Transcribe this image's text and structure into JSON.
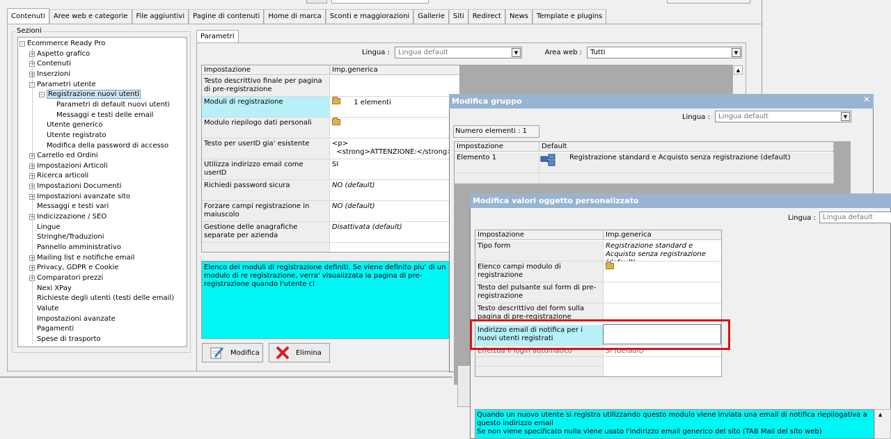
{
  "main_tabs": [
    "Contenuti",
    "Aree web e categorie",
    "File aggiuntivi",
    "Pagine di contenuti",
    "Home di marca",
    "Sconti e maggiorazioni",
    "Gallerie",
    "Siti",
    "Redirect",
    "News",
    "Template e plugins"
  ],
  "sections": {
    "legend": "Sezioni",
    "tree": [
      {
        "label": "Ecommerce Ready Pro",
        "level": 0,
        "exp": "-"
      },
      {
        "label": "Aspetto grafico",
        "level": 1,
        "exp": "+"
      },
      {
        "label": "Contenuti",
        "level": 1,
        "exp": "+"
      },
      {
        "label": "Inserzioni",
        "level": 1,
        "exp": "+"
      },
      {
        "label": "Parametri utente",
        "level": 1,
        "exp": "-"
      },
      {
        "label": "Registrazione nuovi utenti",
        "level": 2,
        "exp": "-",
        "selected": true
      },
      {
        "label": "Parametri di default nuovi utenti",
        "level": 3,
        "exp": ""
      },
      {
        "label": "Messaggi e testi delle email",
        "level": 3,
        "exp": ""
      },
      {
        "label": "Utente generico",
        "level": 2,
        "exp": ""
      },
      {
        "label": "Utente registrato",
        "level": 2,
        "exp": ""
      },
      {
        "label": "Modifica della password di accesso",
        "level": 2,
        "exp": ""
      },
      {
        "label": "Carrello ed Ordini",
        "level": 1,
        "exp": "+"
      },
      {
        "label": "Impostazioni Articoli",
        "level": 1,
        "exp": "+"
      },
      {
        "label": "Ricerca articoli",
        "level": 1,
        "exp": "+"
      },
      {
        "label": "Impostazioni Documenti",
        "level": 1,
        "exp": "+"
      },
      {
        "label": "Impostazioni avanzate sito",
        "level": 1,
        "exp": "+"
      },
      {
        "label": "Messaggi e testi vari",
        "level": 1,
        "exp": ""
      },
      {
        "label": "Indicizzazione / SEO",
        "level": 1,
        "exp": "+"
      },
      {
        "label": "Lingue",
        "level": 1,
        "exp": ""
      },
      {
        "label": "Stringhe/Traduzioni",
        "level": 1,
        "exp": ""
      },
      {
        "label": "Pannello amministrativo",
        "level": 1,
        "exp": ""
      },
      {
        "label": "Mailing list e notifiche email",
        "level": 1,
        "exp": "+"
      },
      {
        "label": "Privacy, GDPR e Cookie",
        "level": 1,
        "exp": "+"
      },
      {
        "label": "Comparatori prezzi",
        "level": 1,
        "exp": "+"
      },
      {
        "label": "Nexi XPay",
        "level": 1,
        "exp": ""
      },
      {
        "label": "Richieste degli utenti (testi delle email)",
        "level": 1,
        "exp": ""
      },
      {
        "label": "Valute",
        "level": 1,
        "exp": ""
      },
      {
        "label": "Impostazioni avanzate",
        "level": 1,
        "exp": ""
      },
      {
        "label": "Pagamenti",
        "level": 1,
        "exp": ""
      },
      {
        "label": "Spese di trasporto",
        "level": 1,
        "exp": ""
      }
    ]
  },
  "params": {
    "tab": "Parametri",
    "lingua_label": "Lingua :",
    "lingua_value": "Lingua default",
    "area_label": "Area web :",
    "area_value": "Tutti",
    "col_impostazione": "Impostazione",
    "col_generica": "Imp.generica",
    "rows": [
      {
        "name": "Testo descrittivo finale per pagina di pre-registrazione",
        "value": ""
      },
      {
        "name": "Moduli di registrazione",
        "value": "1 elementi"
      },
      {
        "name": "Modulo riepilogo dati personali",
        "value": ""
      },
      {
        "name": "Testo per userID gia' esistente",
        "value": "<p>\n  <strong>ATTENZIONE:</strong> lo"
      },
      {
        "name": "Utilizza indirizzo email come userID",
        "value": "SI"
      },
      {
        "name": "Richiedi password sicura",
        "value": "NO (default)"
      },
      {
        "name": "Forzare campi registrazione in maiuscolo",
        "value": "NO (default)"
      },
      {
        "name": "Gestione delle anagrafiche separate per azienda",
        "value": "Disattivata (default)"
      }
    ],
    "description": "Elenco dei moduli di registrazione definiti. Se viene definito piu' di un modulo di re registrazione, verra' visualizzata la pagina di pre-registrazione quando l'utente cl",
    "btn_modifica": "Modifica",
    "btn_elimina": "Elimina"
  },
  "dialog_group": {
    "title": "Modifica gruppo",
    "lingua_label": "Lingua :",
    "lingua_value": "Lingua default",
    "count": "Numero elementi : 1",
    "col_impostazione": "Impostazione",
    "col_default": "Default",
    "row_name": "Elemento 1",
    "row_value": "Registrazione standard e Acquisto senza registrazione (default)"
  },
  "dialog_values": {
    "title": "Modifica valori oggetto personalizzato",
    "lingua_label": "Lingua :",
    "lingua_value": "Lingua default",
    "col_impostazione": "Impostazione",
    "col_generica": "Imp.generica",
    "rows": [
      {
        "name": "Tipo form",
        "value": "Registrazione standard e Acquisto senza registrazione (default)"
      },
      {
        "name": "Elenco campi modulo di registrazione",
        "value": ""
      },
      {
        "name": "Testo del pulsante sul form di pre-registrazione",
        "value": ""
      },
      {
        "name": "Testo descrittivo del form sulla pagina di pre-registrazione",
        "value": ""
      },
      {
        "name": "Indirizzo email di notifica per i nuovi utenti registrati",
        "value": ""
      },
      {
        "name": "Effettua il login automatico",
        "value": "SI (default)"
      }
    ],
    "description_1": "Quando un nuovo utente si registra utilizzando questo modulo viene inviata una email di notifica riepilogativa a questo indirizzo email",
    "description_2": "Se non viene specificato nulla viene usato l'indirizzo email generico del sito (TAB Mail del sito web)"
  },
  "colors": {
    "highlight_cyan": "#00f5f5",
    "title_bar": "#99b4d1",
    "red_callout": "#e01010",
    "selected_row": "#b8f0f8"
  }
}
